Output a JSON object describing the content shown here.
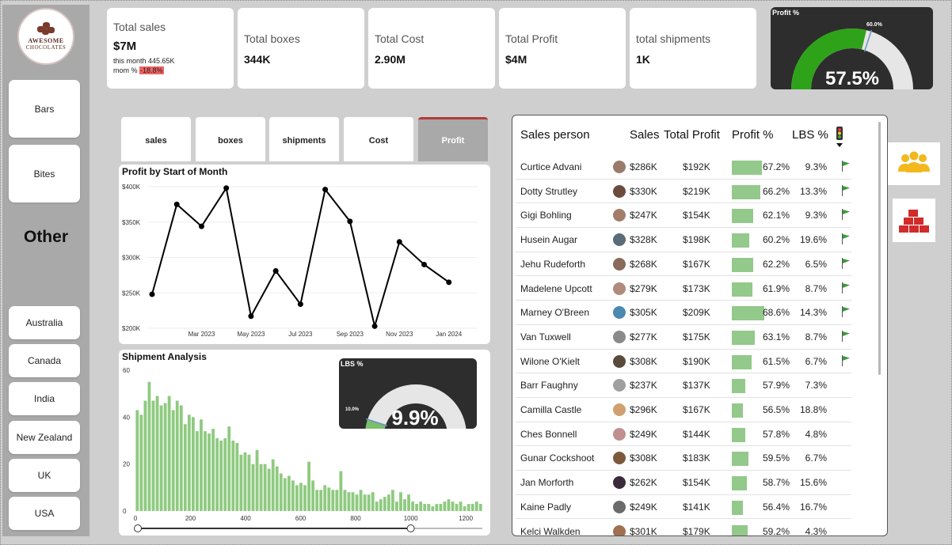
{
  "brand": {
    "line1": "AWESOME",
    "line2": "CHOCOLATES"
  },
  "sidebar": {
    "categories": [
      "Bars",
      "Bites"
    ],
    "other_label": "Other",
    "countries": [
      "Australia",
      "Canada",
      "India",
      "New Zealand",
      "UK",
      "USA"
    ]
  },
  "kpis": {
    "total_sales": {
      "label": "Total sales",
      "value": "$7M",
      "this_month": "this month 445.65K",
      "mom_label": "mom %",
      "mom_value": "-18.8%"
    },
    "total_boxes": {
      "label": "Total boxes",
      "value": "344K"
    },
    "total_cost": {
      "label": "Total Cost",
      "value": "2.90M"
    },
    "total_profit": {
      "label": "Total Profit",
      "value": "$4M"
    },
    "total_shipments": {
      "label": "total shipments",
      "value": "1K"
    }
  },
  "profit_gauge": {
    "title": "Profit %",
    "value_label": "57.5%",
    "target_label": "60.0%",
    "value": 57.5,
    "target": 60.0,
    "fill_color": "#2ea31a",
    "track_color": "#e6e6e6"
  },
  "tabs": [
    "sales",
    "boxes",
    "shipments",
    "Cost",
    "Profit"
  ],
  "active_tab": "Profit",
  "profit_chart": {
    "title": "Profit by Start of Month",
    "chart_data": {
      "type": "line",
      "title": "Profit by Start of Month",
      "x": [
        "2023-01",
        "2023-02",
        "2023-03",
        "2023-04",
        "2023-05",
        "2023-06",
        "2023-07",
        "2023-08",
        "2023-09",
        "2023-10",
        "2023-11",
        "2023-12",
        "2024-01",
        "2024-02"
      ],
      "values": [
        248000,
        375000,
        344000,
        398000,
        217000,
        281000,
        234000,
        396000,
        351000,
        203000,
        322000,
        290000,
        265000,
        null
      ],
      "y_ticks": [
        "$200K",
        "$250K",
        "$300K",
        "$350K",
        "$400K"
      ],
      "x_ticks": [
        "Mar 2023",
        "May 2023",
        "Jul 2023",
        "Sep 2023",
        "Nov 2023",
        "Jan 2024"
      ],
      "ylim": [
        200000,
        400000
      ],
      "grid": true
    }
  },
  "shipment_chart": {
    "title": "Shipment Analysis",
    "chart_data": {
      "type": "bar",
      "title": "Shipment Analysis",
      "x_ticks": [
        "0",
        "200",
        "400",
        "600",
        "800",
        "1000",
        "1200"
      ],
      "y_ticks": [
        "0",
        "20",
        "40",
        "60"
      ],
      "xlim": [
        0,
        1260
      ],
      "ylim": [
        0,
        60
      ],
      "bin_width": 14.5,
      "values": [
        43,
        41,
        47,
        55,
        47,
        49,
        45,
        46,
        49,
        43,
        47,
        45,
        37,
        41,
        40,
        34,
        39,
        34,
        33,
        35,
        31,
        30,
        31,
        36,
        30,
        29,
        24,
        25,
        24,
        20,
        26,
        20,
        20,
        18,
        22,
        19,
        16,
        14,
        15,
        13,
        11,
        12,
        11,
        21,
        13,
        9,
        9,
        11,
        10,
        9,
        9,
        17,
        9,
        8,
        8,
        7,
        9,
        7,
        7,
        8,
        4,
        5,
        6,
        7,
        9,
        4,
        8,
        5,
        7,
        4,
        3,
        4,
        3,
        3,
        2,
        3,
        3,
        4,
        5,
        4,
        3,
        4,
        2,
        3,
        3,
        4,
        3,
        2,
        3,
        3,
        2,
        3,
        2,
        3,
        2,
        3,
        2,
        3,
        2,
        2,
        2,
        2,
        2,
        2,
        2,
        2,
        2,
        2,
        2,
        2,
        2,
        2,
        2,
        2,
        3,
        2,
        2,
        2,
        2,
        2,
        2,
        2,
        2,
        2,
        2,
        2,
        2,
        2,
        2,
        2,
        2,
        2,
        2,
        2,
        2,
        3,
        2,
        2,
        2,
        2,
        2,
        2,
        2,
        2,
        2,
        2,
        2,
        2,
        2,
        2,
        2,
        2,
        2,
        2,
        2,
        2,
        2,
        2,
        2,
        2,
        2,
        2,
        2,
        2,
        2,
        2,
        2,
        2,
        2,
        2,
        2,
        2,
        2,
        2,
        2,
        2,
        2,
        2,
        2,
        2,
        2,
        2,
        2,
        2,
        2,
        2,
        2,
        2,
        2,
        2,
        2,
        2,
        2,
        2,
        2,
        2,
        2,
        2,
        2,
        2,
        2,
        2,
        2,
        2,
        2,
        2,
        2,
        2,
        2,
        2,
        2,
        2,
        3,
        2,
        2,
        2,
        2,
        2,
        2,
        2,
        2,
        2,
        2,
        2,
        2,
        2,
        2,
        2,
        2,
        2,
        2,
        2,
        2,
        2,
        2,
        2,
        2,
        2,
        2,
        2,
        2,
        2,
        2,
        2,
        2,
        2,
        2,
        2,
        2,
        2,
        2,
        2,
        2,
        2,
        2,
        2,
        2,
        2,
        2,
        2,
        2,
        2,
        2,
        2,
        2,
        2,
        2,
        2,
        2,
        2,
        2,
        2,
        2,
        2,
        2,
        2,
        2,
        2,
        2,
        2,
        2,
        2,
        2,
        2,
        2,
        2,
        2,
        2,
        2,
        2,
        2,
        2,
        2,
        3
      ],
      "bar_color": "#8fca80",
      "slider": {
        "min": 0,
        "max": 1000
      }
    }
  },
  "lbs_gauge": {
    "title": "LBS %",
    "value_label": "9.9%",
    "target_label": "10.0%",
    "value": 9.9,
    "target": 10.0,
    "fill_color": "#7abf6a",
    "track_color": "#e6e6e6"
  },
  "table": {
    "headers": {
      "person": "Sales person",
      "sales": "Sales",
      "profit": "Total Profit",
      "profit_pct": "Profit %",
      "lbs_pct": "LBS %"
    },
    "rows": [
      {
        "name": "Curtice Advani",
        "sales": "$286K",
        "profit": "$192K",
        "pct": "67.2%",
        "pct_val": 67.2,
        "lbs": "9.3%",
        "flag": true
      },
      {
        "name": "Dotty Strutley",
        "sales": "$330K",
        "profit": "$219K",
        "pct": "66.2%",
        "pct_val": 66.2,
        "lbs": "13.3%",
        "flag": true
      },
      {
        "name": "Gigi Bohling",
        "sales": "$247K",
        "profit": "$154K",
        "pct": "62.1%",
        "pct_val": 62.1,
        "lbs": "9.3%",
        "flag": true
      },
      {
        "name": "Husein Augar",
        "sales": "$328K",
        "profit": "$198K",
        "pct": "60.2%",
        "pct_val": 60.2,
        "lbs": "19.6%",
        "flag": true
      },
      {
        "name": "Jehu Rudeforth",
        "sales": "$268K",
        "profit": "$167K",
        "pct": "62.2%",
        "pct_val": 62.2,
        "lbs": "6.5%",
        "flag": true
      },
      {
        "name": "Madelene Upcott",
        "sales": "$279K",
        "profit": "$173K",
        "pct": "61.9%",
        "pct_val": 61.9,
        "lbs": "8.7%",
        "flag": true
      },
      {
        "name": "Marney O'Breen",
        "sales": "$305K",
        "profit": "$209K",
        "pct": "68.6%",
        "pct_val": 68.6,
        "lbs": "14.3%",
        "flag": true
      },
      {
        "name": "Van Tuxwell",
        "sales": "$277K",
        "profit": "$175K",
        "pct": "63.1%",
        "pct_val": 63.1,
        "lbs": "8.7%",
        "flag": true
      },
      {
        "name": "Wilone O'Kielt",
        "sales": "$308K",
        "profit": "$190K",
        "pct": "61.5%",
        "pct_val": 61.5,
        "lbs": "6.7%",
        "flag": true
      },
      {
        "name": "Barr Faughny",
        "sales": "$237K",
        "profit": "$137K",
        "pct": "57.9%",
        "pct_val": 57.9,
        "lbs": "7.3%",
        "flag": false
      },
      {
        "name": "Camilla Castle",
        "sales": "$296K",
        "profit": "$167K",
        "pct": "56.5%",
        "pct_val": 56.5,
        "lbs": "18.8%",
        "flag": false
      },
      {
        "name": "Ches Bonnell",
        "sales": "$249K",
        "profit": "$144K",
        "pct": "57.8%",
        "pct_val": 57.8,
        "lbs": "4.8%",
        "flag": false
      },
      {
        "name": "Gunar Cockshoot",
        "sales": "$308K",
        "profit": "$183K",
        "pct": "59.5%",
        "pct_val": 59.5,
        "lbs": "6.7%",
        "flag": false
      },
      {
        "name": "Jan Morforth",
        "sales": "$262K",
        "profit": "$154K",
        "pct": "58.7%",
        "pct_val": 58.7,
        "lbs": "15.6%",
        "flag": false
      },
      {
        "name": "Kaine Padly",
        "sales": "$249K",
        "profit": "$141K",
        "pct": "56.4%",
        "pct_val": 56.4,
        "lbs": "16.7%",
        "flag": false
      },
      {
        "name": "Kelci Walkden",
        "sales": "$301K",
        "profit": "$179K",
        "pct": "59.2%",
        "pct_val": 59.2,
        "lbs": "4.3%",
        "flag": false
      }
    ],
    "bar_color": "#93c98a",
    "flag_color": "#3a9a3a"
  },
  "side_icons": [
    "people-icon",
    "boxes-icon"
  ]
}
